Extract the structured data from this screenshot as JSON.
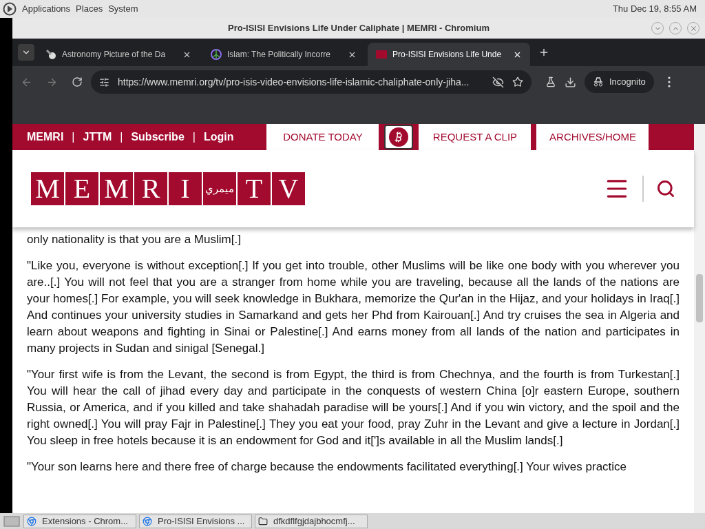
{
  "desktop_panel": {
    "menus": [
      "Applications",
      "Places",
      "System"
    ],
    "clock": "Thu Dec 19, 8:55 AM"
  },
  "window": {
    "title": "Pro-ISISI Envisions Life Under Caliphate | MEMRI - Chromium"
  },
  "tabs": [
    {
      "label": "Astronomy Picture of the Da",
      "selected": false,
      "kind": "space"
    },
    {
      "label": "Islam: The Politically Incorre",
      "selected": false,
      "kind": "peace"
    },
    {
      "label": "Pro-ISISI Envisions Life Unde",
      "selected": true,
      "kind": "memri"
    }
  ],
  "address_bar": {
    "url": "https://www.memri.org/tv/pro-isis-video-envisions-life-islamic-chaliphate-only-jiha...",
    "profile": "Incognito"
  },
  "site_nav": {
    "links": [
      "MEMRI",
      "JTTM",
      "Subscribe",
      "Login"
    ],
    "separator": "|",
    "buttons": [
      {
        "label": "DONATE TODAY",
        "kind": "text"
      },
      {
        "kind": "bitcoin"
      },
      {
        "label": "REQUEST A CLIP",
        "kind": "text"
      },
      {
        "label": "ARCHIVES/HOME",
        "kind": "text"
      }
    ]
  },
  "logo": {
    "tiles": [
      "M",
      "E",
      "M",
      "R",
      "I",
      "ميمري",
      "T",
      "V"
    ]
  },
  "article": {
    "paragraphs": [
      "only nationality is that you are a Muslim[.]",
      "\"Like you, everyone is without exception[.] If you get into trouble, other Muslims will be like one body with you wherever you are..[.] You will not feel that you are a stranger from home while you are traveling, because all the lands of the nations are your homes[.] For example, you will seek knowledge in Bukhara, memorize the Qur'an in the Hijaz, and your holidays in Iraq[.] And continues your university studies in Samarkand and gets her Phd from Kairouan[.] And try cruises the sea in Algeria and learn about weapons and fighting in Sinai or Palestine[.] And earns money from all lands of the nation and participates in many projects in Sudan and sinigal [Senegal.]",
      "\"Your first wife is from the Levant, the second is from Egypt, the third is from Chechnya, and the fourth is from Turkestan[.] You will hear the call of jihad every day and participate in the conquests of western China [o]r eastern Europe, southern Russia, or America, and if you killed and take shahadah paradise will be yours[.] And if you win victory, and the spoil and the right owned[.] You will pray Fajr in Palestine[.] They you eat your food, pray Zuhr in the Levant and give a lecture in Jordan[.] You sleep in free hotels because it is an endowment for God and it[']s available in all the Muslim lands[.]",
      "\"Your son learns here and there free of charge because the endowments facilitated everything[.] Your wives practice"
    ]
  },
  "taskbar": {
    "items": [
      {
        "label": "Extensions - Chrom...",
        "kind": "browser"
      },
      {
        "label": "Pro-ISISI Envisions ...",
        "kind": "browser"
      },
      {
        "label": "dfkdflfgjdajbhocmfj...",
        "kind": "folder"
      }
    ]
  }
}
